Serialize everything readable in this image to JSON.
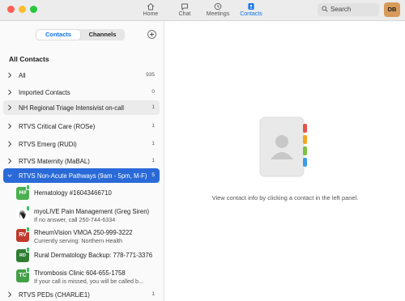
{
  "nav": {
    "tabs": [
      {
        "label": "Home",
        "icon": "home-icon"
      },
      {
        "label": "Chat",
        "icon": "chat-icon"
      },
      {
        "label": "Meetings",
        "icon": "clock-icon"
      },
      {
        "label": "Contacts",
        "icon": "contacts-icon",
        "active": true
      }
    ],
    "search_placeholder": "Search",
    "avatar_initials": "DB"
  },
  "sidebar": {
    "segments": {
      "contacts": "Contacts",
      "channels": "Channels"
    },
    "heading": "All Contacts",
    "groups": [
      {
        "name": "All",
        "count": "935"
      },
      {
        "name": "Imported Contacts",
        "count": "0"
      },
      {
        "name": "NH Regional Triage Intensivist on-call",
        "count": "1"
      },
      {
        "name": "RTVS Critical Care (ROSe)",
        "count": "1"
      },
      {
        "name": "RTVS Emerg (RUDi)",
        "count": "1"
      },
      {
        "name": "RTVS Maternity (MaBAL)",
        "count": "1"
      },
      {
        "name": "RTVS Non-Acute Pathways (9am - 5pm, M-F)",
        "count": "5"
      }
    ],
    "contacts": [
      {
        "initials": "H#",
        "name": "Hematology #16043466710",
        "sub": ""
      },
      {
        "initials": "",
        "name": "myoLIVE Pain Management (Greg Siren)",
        "sub": "If no answer, call 250-744-6334"
      },
      {
        "initials": "RV",
        "name": "RheumVision VMOA 250-999-3222",
        "sub": "Currently serving: Northern Health"
      },
      {
        "initials": "RD",
        "name": "Rural Dermatology Backup: 778-771-3376",
        "sub": ""
      },
      {
        "initials": "TC",
        "name": "Thrombosis Clinic 604-655-1758",
        "sub": "If your call is missed, you will be called b..."
      }
    ],
    "last_group": {
      "name": "RTVS PEDs (CHARLiE1)",
      "count": "1"
    }
  },
  "main": {
    "hint": "View contact info by clicking a contact in the left panel."
  },
  "colors": {
    "accent": "#0e71eb",
    "selected_row": "#2a6ad8",
    "online": "#3cc35f"
  }
}
